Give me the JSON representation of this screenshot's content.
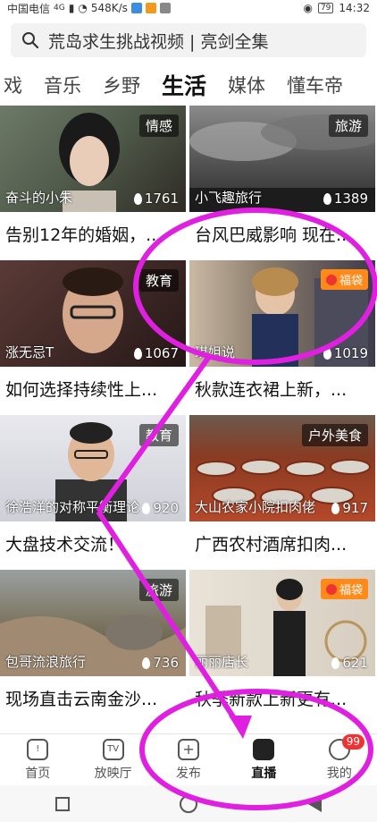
{
  "status": {
    "carrier": "中国电信",
    "net": "4G",
    "speed": "548K/s",
    "battery": "79",
    "time": "14:32"
  },
  "search": {
    "placeholder": "荒岛求生挑战视频 | 亮剑全集"
  },
  "tabs": [
    {
      "label": "戏"
    },
    {
      "label": "音乐"
    },
    {
      "label": "乡野"
    },
    {
      "label": "生活",
      "active": true
    },
    {
      "label": "媒体"
    },
    {
      "label": "懂车帝"
    }
  ],
  "cards": [
    {
      "owner": "奋斗的小朱",
      "count": "1761",
      "tag": "情感",
      "title": "告别12年的婚姻，..."
    },
    {
      "owner": "小飞趣旅行",
      "count": "1389",
      "tag": "旅游",
      "title": "台风巴威影响 现在..."
    },
    {
      "owner": "涨无忌T",
      "count": "1067",
      "tag": "教育",
      "title": "如何选择持续性上..."
    },
    {
      "owner": "琪姐说",
      "count": "1019",
      "badge": "福袋",
      "title": "秋款连衣裙上新，..."
    },
    {
      "owner": "徐浩洋的对称平衡理论",
      "count": "920",
      "tag": "教育",
      "title": "大盘技术交流！"
    },
    {
      "owner": "大山农家小院扣肉佬",
      "count": "917",
      "tag": "户外美食",
      "title": "广西农村酒席扣肉..."
    },
    {
      "owner": "包哥流浪旅行",
      "count": "736",
      "tag": "旅游",
      "title": "现场直击云南金沙..."
    },
    {
      "owner": "丽丽店长",
      "count": "621",
      "badge": "福袋",
      "title": "秋季新款上新更有..."
    }
  ],
  "nav": [
    {
      "label": "首页",
      "icon": "home-icon"
    },
    {
      "label": "放映厅",
      "icon": "tv-icon"
    },
    {
      "label": "发布",
      "icon": "plus-icon"
    },
    {
      "label": "直播",
      "icon": "camera-icon",
      "active": true
    },
    {
      "label": "我的",
      "icon": "user-icon",
      "badge": "99"
    }
  ],
  "colors": {
    "accent": "#e33333",
    "annotation": "#e020e0",
    "fudai": "#ff8a1a"
  }
}
